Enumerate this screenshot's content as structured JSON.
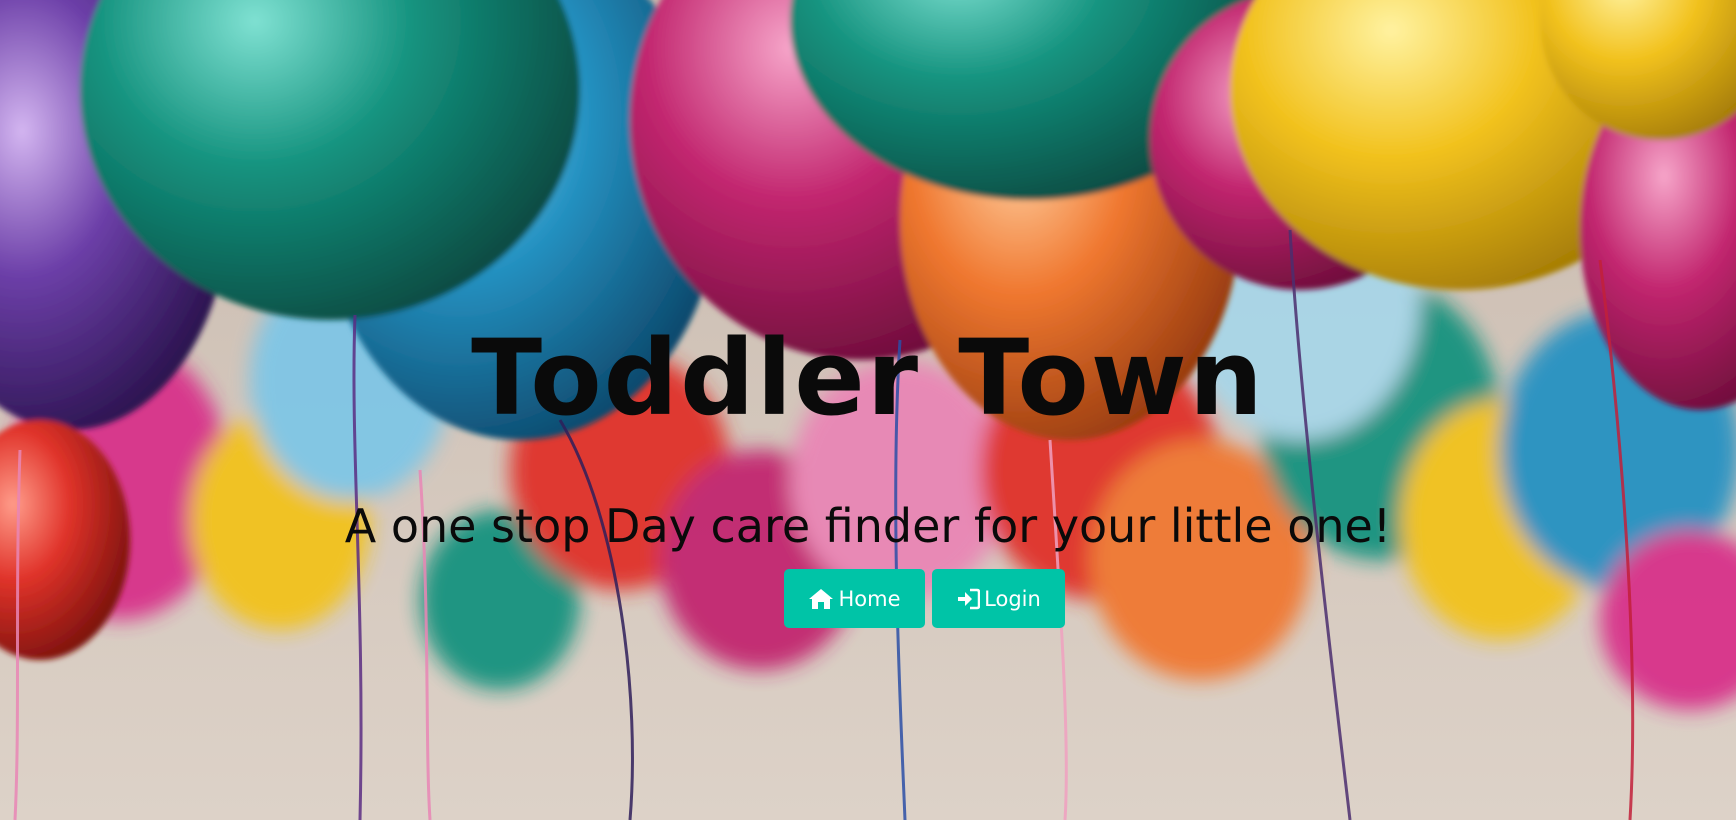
{
  "hero": {
    "title": "Toddler Town",
    "subtitle": "A one stop Day care finder for your little one!",
    "background": "balloons-photo"
  },
  "nav": {
    "home_label": "Home",
    "home_icon": "home-icon",
    "login_label": "Login",
    "login_icon": "sign-in-icon"
  },
  "colors": {
    "button": "#00c4a7",
    "button_text": "#ffffff",
    "heading": "#0a0a0a"
  }
}
